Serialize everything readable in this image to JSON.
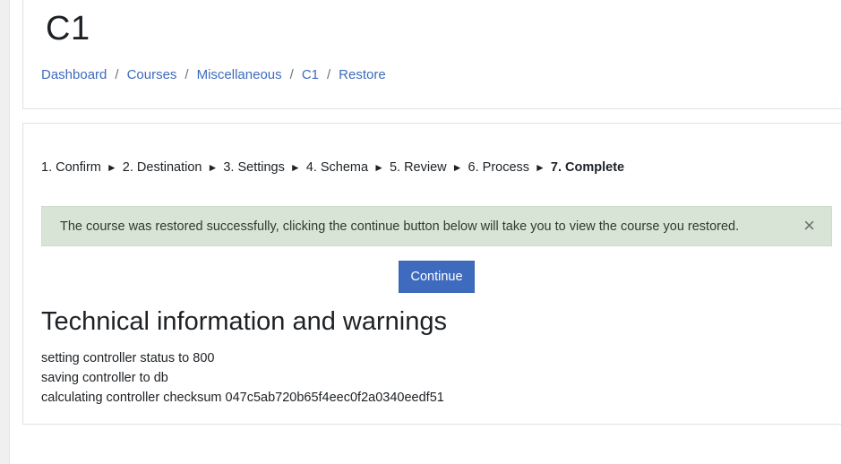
{
  "header": {
    "title": "C1",
    "breadcrumb": [
      "Dashboard",
      "Courses",
      "Miscellaneous",
      "C1",
      "Restore"
    ],
    "separator": "/"
  },
  "steps": {
    "items": [
      "1. Confirm",
      "2. Destination",
      "3. Settings",
      "4. Schema",
      "5. Review",
      "6. Process",
      "7. Complete"
    ],
    "arrow": "►",
    "current_index": 6
  },
  "alert": {
    "message": "The course was restored successfully, clicking the continue button below will take you to view the course you restored.",
    "close_glyph": "×",
    "color": "#d8e4d6"
  },
  "continue_button": {
    "label": "Continue",
    "color": "#3e6bbd"
  },
  "technical": {
    "heading": "Technical information and warnings",
    "lines": [
      "setting controller status to 800",
      "saving controller to db",
      "calculating controller checksum 047c5ab720b65f4eec0f2a0340eedf51"
    ]
  }
}
